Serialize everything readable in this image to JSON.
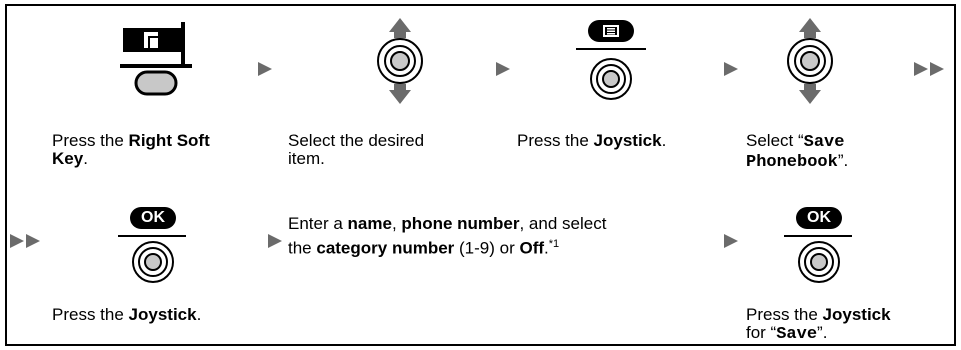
{
  "steps": {
    "s1": {
      "pre": "Press the ",
      "b1": "Right Soft",
      "b2": "Key",
      "post": "."
    },
    "s2": {
      "l1": "Select the desired",
      "l2": "item."
    },
    "s3": {
      "pre": "Press the ",
      "b": "Joystick",
      "post": "."
    },
    "s4": {
      "pre": "Select “",
      "m1": "Save",
      "m2": "Phonebook",
      "post": "”."
    },
    "s5": {
      "pre": "Press the ",
      "b": "Joystick",
      "post": "."
    },
    "s6": {
      "l1_pre": "Enter a ",
      "l1_b1": "name",
      "l1_mid": ", ",
      "l1_b2": "phone number",
      "l1_post": ", and select",
      "l2_pre": "the ",
      "l2_b1": "category number",
      "l2_mid": " (1-9) or ",
      "l2_b2": "Off",
      "l2_post": ".",
      "sup": "*1"
    },
    "s7": {
      "pre": "Press the ",
      "b": "Joystick",
      "l2_pre": "for “",
      "m": "Save",
      "l2_post": "”."
    }
  },
  "buttons": {
    "ok1": "OK",
    "ok2": "OK"
  },
  "icons": [
    "soft-key-icon",
    "joystick-up-down-icon",
    "menu-button-icon",
    "joystick-press-icon",
    "arrow-right-icon",
    "double-arrow-right-icon",
    "ok-button-icon"
  ]
}
